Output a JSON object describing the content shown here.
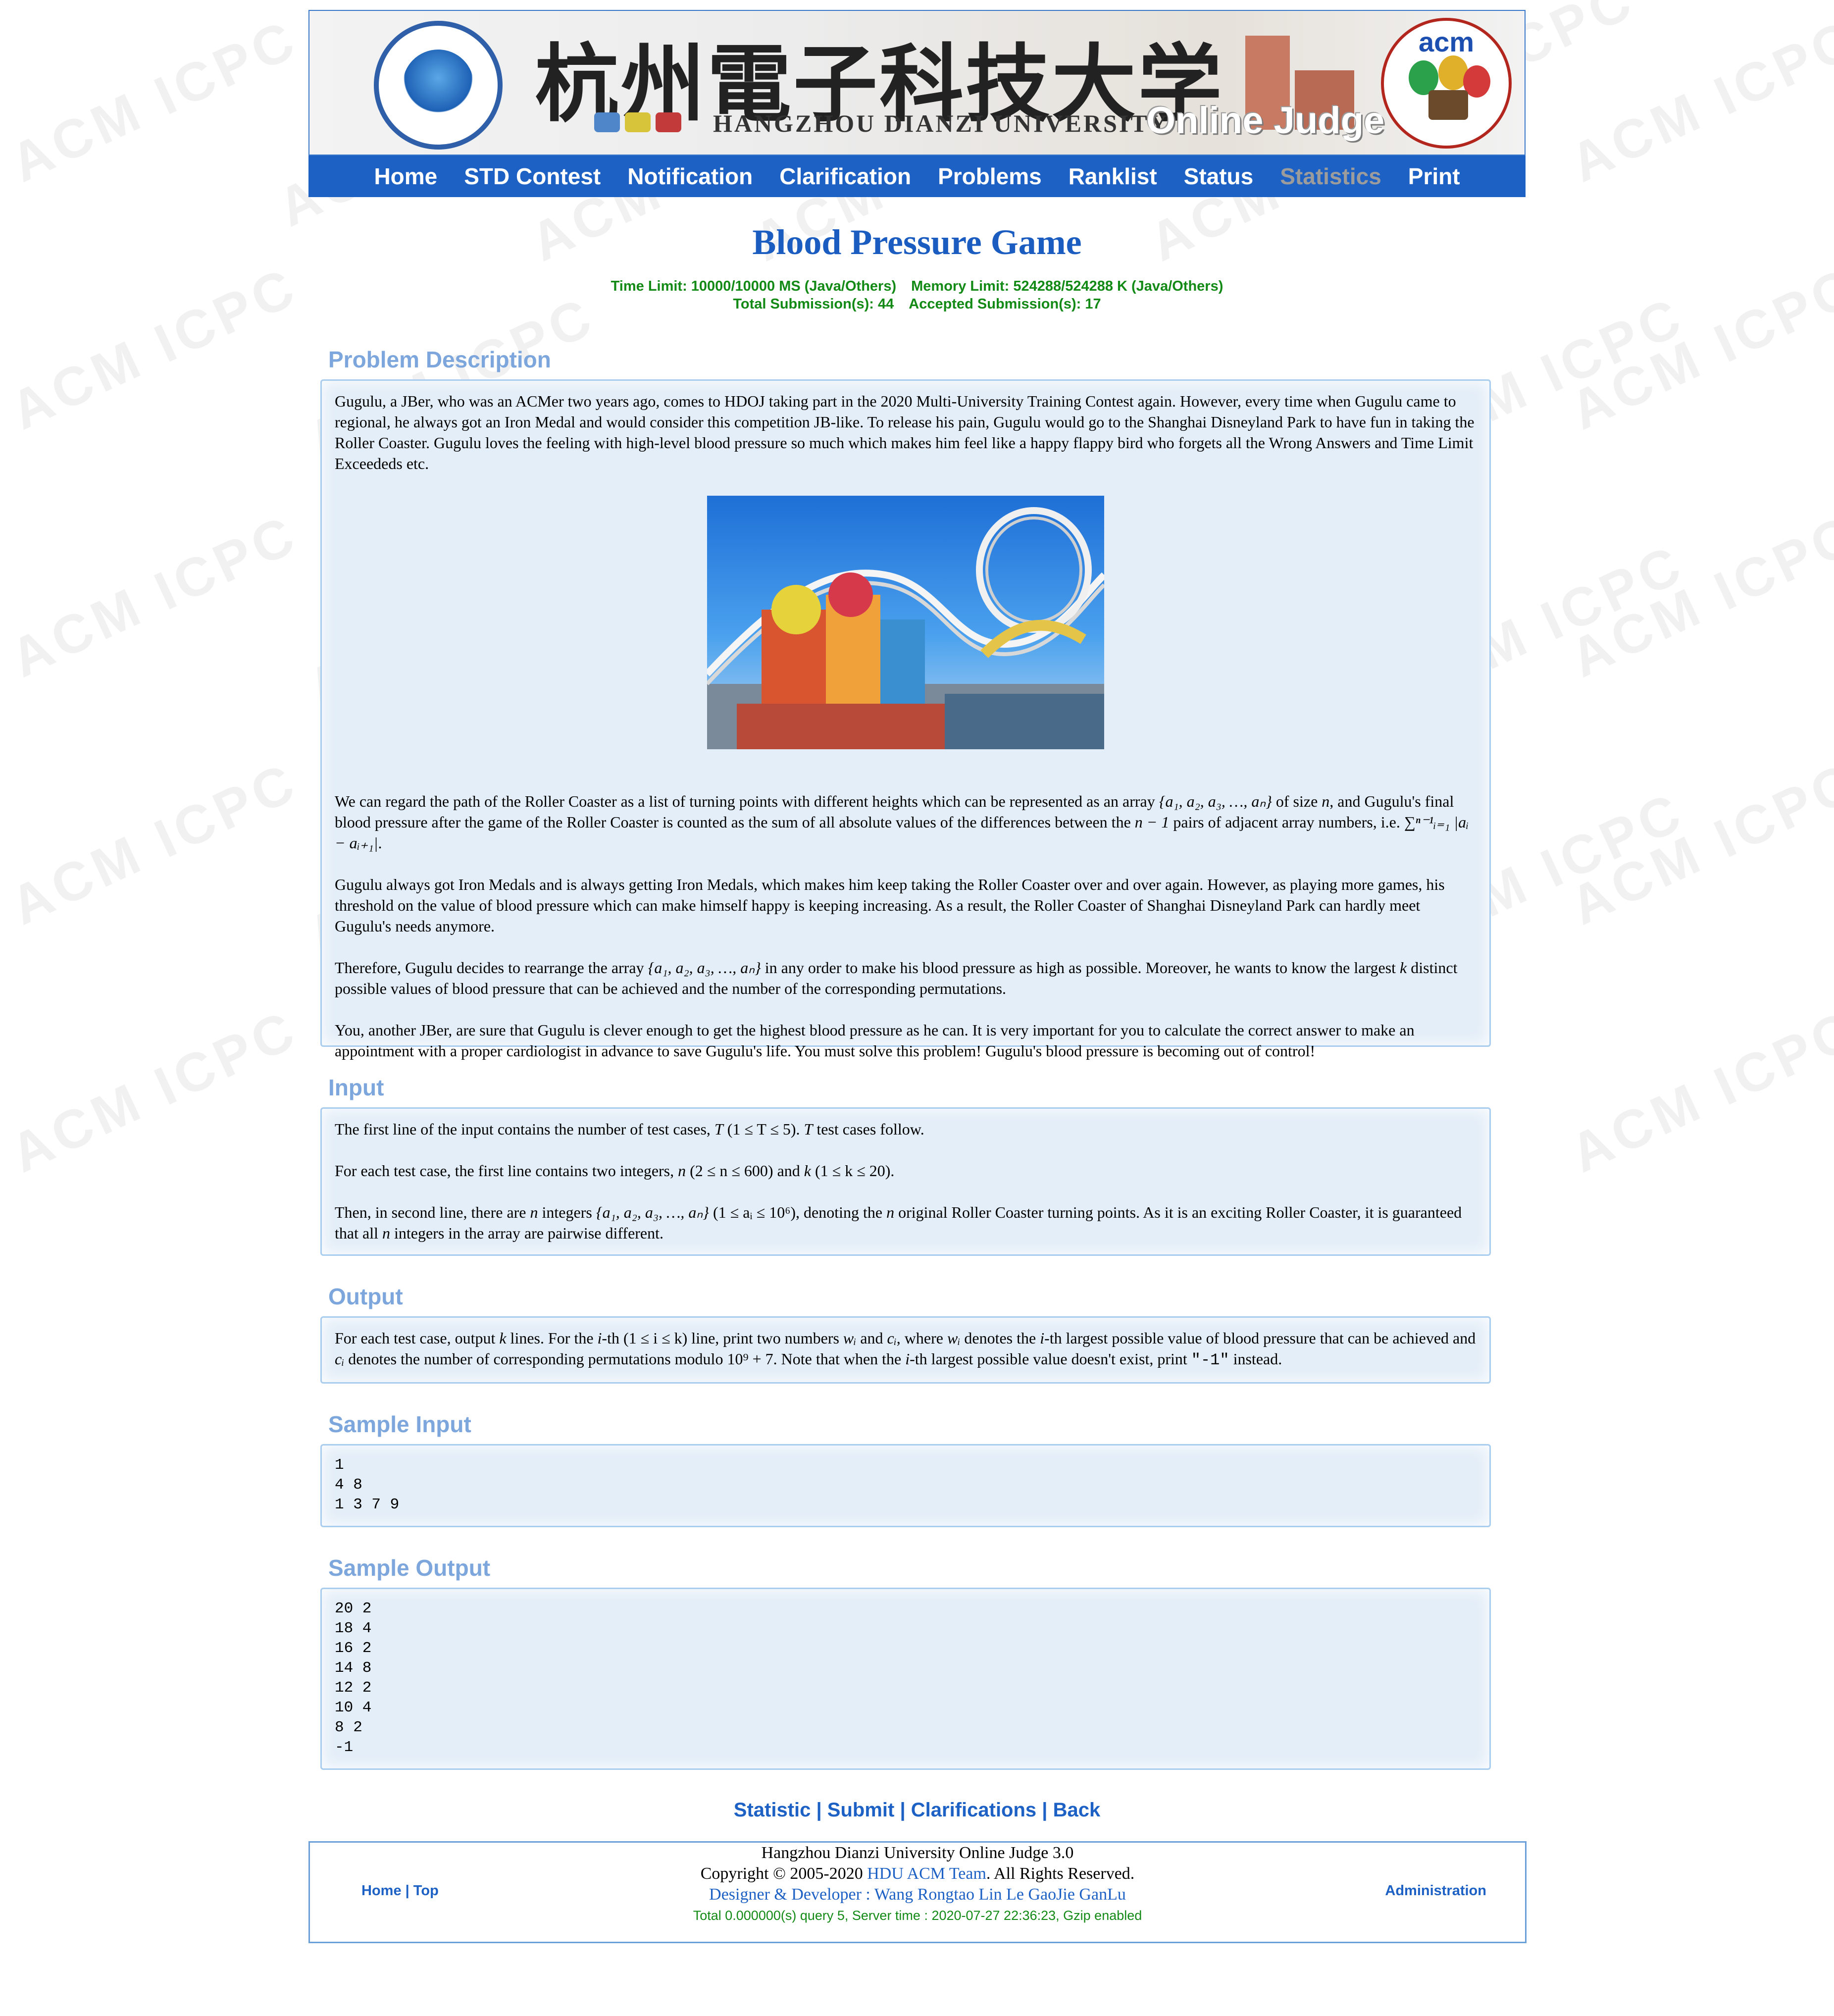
{
  "watermark": "ACM ICPC",
  "banner": {
    "cn_title": "杭州電子科技大学",
    "en_title": "HANGZHOU DIANZI UNIVERSITY",
    "oj_title": "Online Judge",
    "acm_logo": "acm"
  },
  "nav": [
    "Home",
    "STD Contest",
    "Notification",
    "Clarification",
    "Problems",
    "Ranklist",
    "Status",
    "Statistics",
    "Print"
  ],
  "problem": {
    "title": "Blood Pressure Game",
    "time_limit": "Time Limit: 10000/10000 MS (Java/Others)",
    "memory_limit": "Memory Limit: 524288/524288 K (Java/Others)",
    "total_submissions": "Total Submission(s): 44",
    "accepted_submissions": "Accepted Submission(s): 17"
  },
  "sections": {
    "description": "Problem Description",
    "input": "Input",
    "output": "Output",
    "sample_input": "Sample Input",
    "sample_output": "Sample Output"
  },
  "description": {
    "p1": "Gugulu, a JBer, who was an ACMer two years ago, comes to HDOJ taking part in the 2020 Multi-University Training Contest again. However, every time when Gugulu came to regional, he always got an Iron Medal and would consider this competition JB-like. To release his pain, Gugulu would go to the Shanghai Disneyland Park to have fun in taking the Roller Coaster. Gugulu loves the feeling with high-level blood pressure so much which makes him feel like a happy flappy bird who forgets all the Wrong Answers and Time Limit Exceededs etc.",
    "p2a": "We can regard the path of the Roller Coaster as a list of turning points with different heights which can be represented as an array ",
    "p2_array": "{a₁, a₂, a₃, …, aₙ}",
    "p2b": " of size ",
    "p2_n": "n",
    "p2c": ", and Gugulu's final blood pressure after the game of the Roller Coaster is counted as the sum of all absolute values of the differences between the ",
    "p2_n1": "n − 1",
    "p2d": " pairs of adjacent array numbers, i.e. ",
    "p2_sum": "∑ⁿ⁻¹ᵢ₌₁ |aᵢ − aᵢ₊₁|",
    "p2e": ".",
    "p3": "Gugulu always got Iron Medals and is always getting Iron Medals, which makes him keep taking the Roller Coaster over and over again. However, as playing more games, his threshold on the value of blood pressure which can make himself happy is keeping increasing. As a result, the Roller Coaster of Shanghai Disneyland Park can hardly meet Gugulu's needs anymore.",
    "p4a": "Therefore, Gugulu decides to rearrange the array ",
    "p4_array": "{a₁, a₂, a₃, …, aₙ}",
    "p4b": " in any order to make his blood pressure as high as possible. Moreover, he wants to know the largest ",
    "p4_k": "k",
    "p4c": " distinct possible values of blood pressure that can be achieved and the number of the corresponding permutations.",
    "p5": "You, another JBer, are sure that Gugulu is clever enough to get the highest blood pressure as he can. It is very important for you to calculate the correct answer to make an appointment with a proper cardiologist in advance to save Gugulu's life. You must solve this problem! Gugulu's blood pressure is becoming out of control!"
  },
  "input": {
    "l1a": "The first line of the input contains the number of test cases, ",
    "l1_T": "T",
    "l1_range": " (1 ≤ T ≤ 5). ",
    "l1_T2": "T",
    "l1b": " test cases follow.",
    "l2a": "For each test case, the first line contains two integers, ",
    "l2_n": "n",
    "l2_nr": " (2 ≤ n ≤ 600)",
    "l2b": " and ",
    "l2_k": "k",
    "l2_kr": " (1 ≤ k ≤ 20)",
    "l2c": ".",
    "l3a": "Then, in second line, there are ",
    "l3_n": "n",
    "l3b": " integers ",
    "l3_array": "{a₁, a₂, a₃, …, aₙ}",
    "l3_range": " (1 ≤ aᵢ ≤ 10⁶)",
    "l3c": ", denoting the ",
    "l3_n2": "n",
    "l3d": " original Roller Coaster turning points. As it is an exciting Roller Coaster, it is guaranteed that all ",
    "l3_n3": "n",
    "l3e": " integers in the array are pairwise different."
  },
  "output": {
    "a": "For each test case, output ",
    "k": "k",
    "b": " lines. For the ",
    "i": "i",
    "c": "-th ",
    "range": "(1 ≤ i ≤ k)",
    "d": " line, print two numbers ",
    "w": "wᵢ",
    "e": " and ",
    "ci": "cᵢ",
    "f": ", where ",
    "w2": "wᵢ",
    "g": " denotes the ",
    "i2": "i",
    "h": "-th largest possible value of blood pressure that can be achieved and ",
    "ci2": "cᵢ",
    "j": " denotes the number of corresponding permutations modulo ",
    "mod": "10⁹ + 7",
    "l": ". Note that when the ",
    "i3": "i",
    "m": "-th largest possible value doesn't exist, print ",
    "neg": "\"-1\"",
    "n": " instead."
  },
  "sample_input": "1\n4 8\n1 3 7 9",
  "sample_output": "20 2\n18 4\n16 2\n14 8\n12 2\n10 4\n8 2\n-1",
  "links": [
    "Statistic",
    "Submit",
    "Clarifications",
    "Back"
  ],
  "links_sep": " | ",
  "footer": {
    "left": "Home | Top",
    "line1": "Hangzhou Dianzi University Online Judge 3.0",
    "line2a": "Copyright © 2005-2020 ",
    "line2_team": "HDU ACM Team",
    "line2b": ". All Rights Reserved.",
    "line3": "Designer & Developer : Wang Rongtao Lin Le GaoJie GanLu",
    "line4": "Total 0.000000(s) query 5, Server time : 2020-07-27 22:36:23, Gzip enabled",
    "right": "Administration"
  },
  "colors": {
    "nav_bg": "#1d61c5",
    "title": "#1a5cc0",
    "section_title": "#7da7dc",
    "panel_bg": "#e4eef8",
    "limits": "#138a16"
  }
}
